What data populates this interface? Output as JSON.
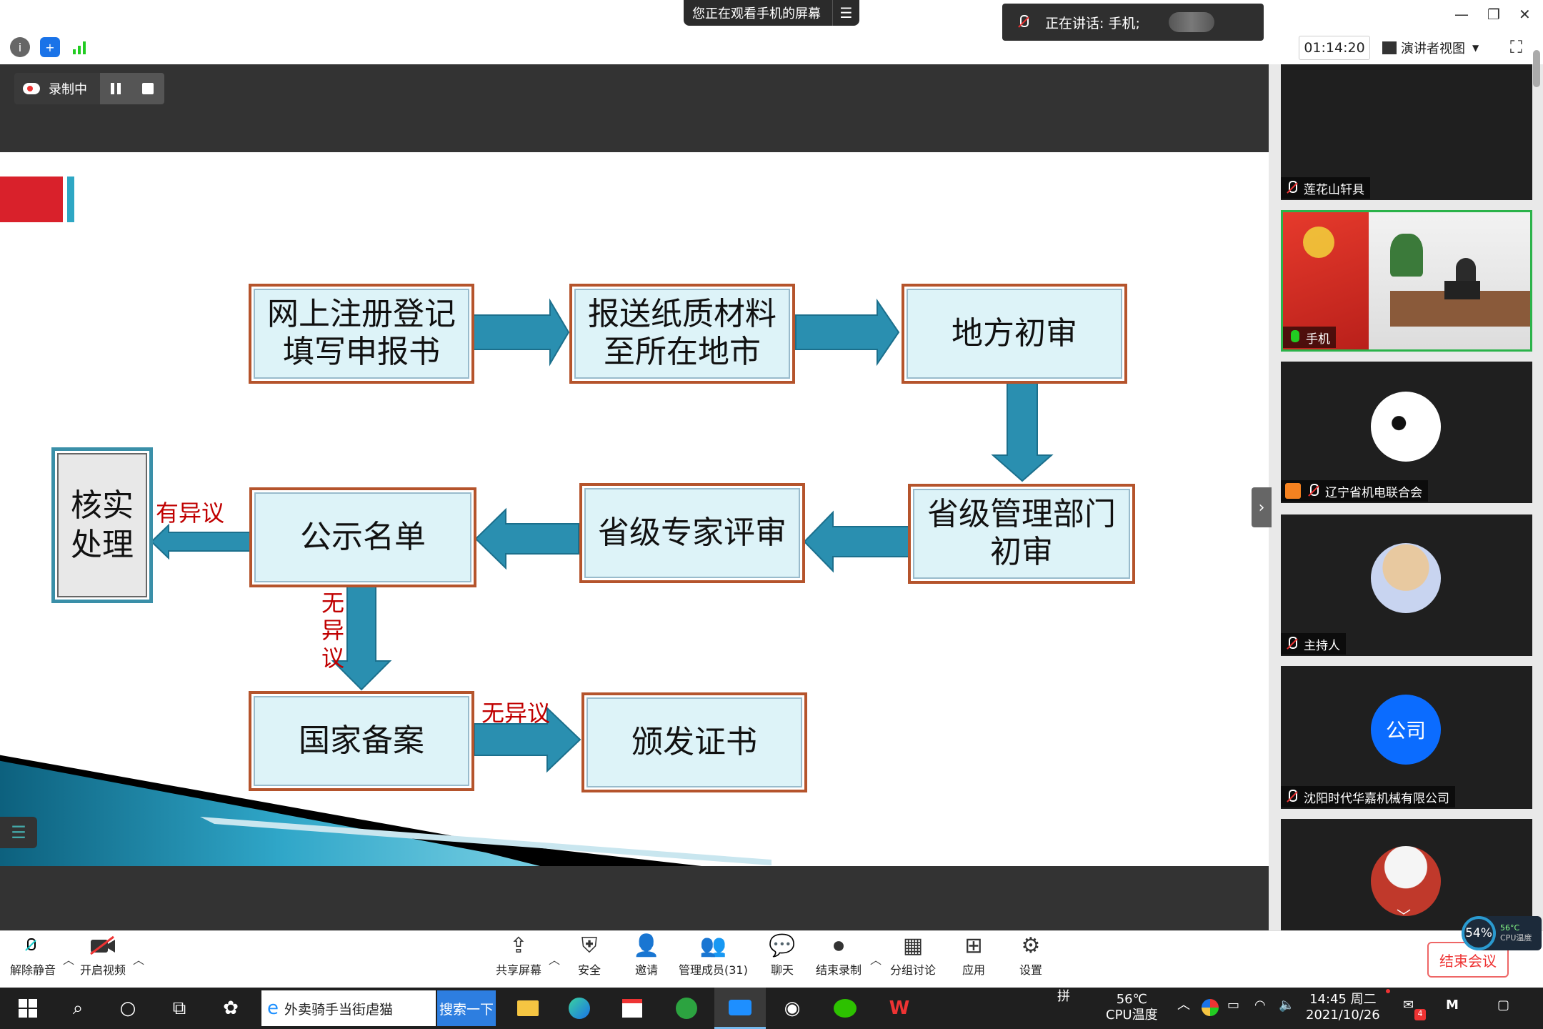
{
  "top": {
    "share_banner": "您正在观看手机的屏幕",
    "speaking": "正在讲话: 手机;",
    "timer": "01:14:20",
    "view_mode": "演讲者视图"
  },
  "recording": {
    "label": "录制中"
  },
  "slide": {
    "boxes": {
      "register": "网上注册登记\n填写申报书",
      "submit": "报送纸质材料\n至所在地市",
      "local_review": "地方初审",
      "provincial_dept": "省级管理部门\n初审",
      "expert_review": "省级专家评审",
      "publicity": "公示名单",
      "verify": "核实\n处理",
      "national": "国家备案",
      "certificate": "颁发证书"
    },
    "labels": {
      "objection": "有异议",
      "no_objection_vertical": "无\n异\n议",
      "no_objection": "无异议"
    }
  },
  "participants": [
    {
      "name": "莲花山轩具",
      "avatar_text": ""
    },
    {
      "name": "手机",
      "avatar_text": ""
    },
    {
      "name": "辽宁省机电联合会",
      "avatar_text": ""
    },
    {
      "name": "主持人",
      "avatar_text": ""
    },
    {
      "name": "沈阳时代华嘉机械有限公司",
      "avatar_text": "公司"
    },
    {
      "name": "",
      "avatar_text": ""
    }
  ],
  "toolbar": {
    "unmute": "解除静音",
    "start_video": "开启视频",
    "share_screen": "共享屏幕",
    "security": "安全",
    "invite": "邀请",
    "manage_members": "管理成员(31)",
    "chat": "聊天",
    "end_recording": "结束录制",
    "breakout": "分组讨论",
    "apps": "应用",
    "settings": "设置",
    "end_meeting": "结束会议"
  },
  "cpu_widget": {
    "percent": "54%",
    "temp": "56°C",
    "label": "CPU温度"
  },
  "taskbar": {
    "search_text": "外卖骑手当街虐猫",
    "search_button": "搜索一下",
    "ime": "拼",
    "cpu_temp": "56℃",
    "cpu_label": "CPU温度",
    "time": "14:45 周二",
    "date": "2021/10/26",
    "notif_count": "4"
  },
  "colors": {
    "slide_red": "#d9212b",
    "arrow": "#2a8fb0",
    "box_border": "#b5542c",
    "box_fill": "#ddf3f8",
    "accent_blue": "#0b6cff"
  }
}
